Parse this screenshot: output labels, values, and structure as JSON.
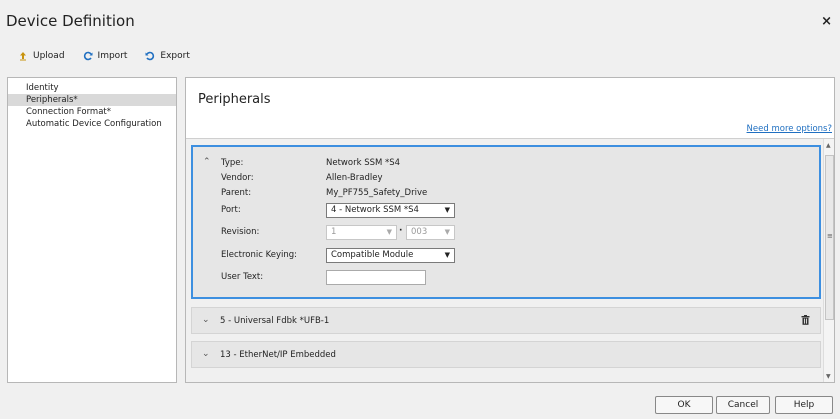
{
  "window": {
    "title": "Device Definition",
    "close_glyph": "×"
  },
  "toolbar": {
    "upload": "Upload",
    "import": "Import",
    "export": "Export"
  },
  "nav": {
    "items": [
      {
        "label": "Identity"
      },
      {
        "label": "Peripherals*"
      },
      {
        "label": "Connection Format*"
      },
      {
        "label": "Automatic Device Configuration"
      }
    ],
    "selected": "Peripherals*"
  },
  "main": {
    "title": "Peripherals",
    "need_more_link": "Need more options?",
    "expanded": {
      "fields": {
        "type_label": "Type:",
        "type_value": "Network SSM *S4",
        "vendor_label": "Vendor:",
        "vendor_value": "Allen-Bradley",
        "parent_label": "Parent:",
        "parent_value": "My_PF755_Safety_Drive",
        "port_label": "Port:",
        "port_value": "4 - Network SSM *S4",
        "revision_label": "Revision:",
        "revision_major": "1",
        "revision_minor": "003",
        "keying_label": "Electronic Keying:",
        "keying_value": "Compatible Module",
        "usertext_label": "User Text:",
        "usertext_value": ""
      }
    },
    "cards": [
      {
        "title": "5 - Universal Fdbk *UFB-1"
      },
      {
        "title": "13 - EtherNet/IP Embedded"
      }
    ]
  },
  "footer": {
    "ok": "OK",
    "cancel": "Cancel",
    "help": "Help"
  }
}
